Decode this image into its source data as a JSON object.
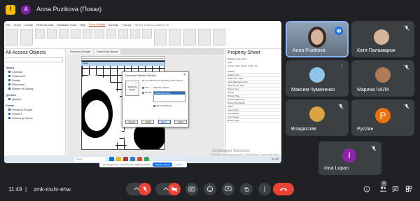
{
  "top_bar": {
    "presenter_initial": "A",
    "presenter_label": "Anna Puzikova (Показ)"
  },
  "shared_screen": {
    "ribbon_tabs": [
      "File",
      "Home",
      "Create",
      "External Data",
      "Database Tools",
      "Help",
      "Form Design",
      "Arrange",
      "Format"
    ],
    "active_ribbon_tab": "Form Design",
    "ribbon_search_hint": "Tell me what you want to do",
    "nav_pane": {
      "title": "All Access Objects",
      "groups": [
        {
          "name": "Tables",
          "items": [
            "Contract",
            "Customers",
            "People",
            "Personnel",
            "Sphere of Activity"
          ]
        },
        {
          "name": "Queries",
          "items": [
            "Query1"
          ]
        },
        {
          "name": "Forms",
          "items": [
            "Previous People",
            "People1",
            "Search by Name"
          ]
        }
      ]
    },
    "doc_tabs": [
      "Previous People",
      "Search by Name"
    ],
    "detail_label": "Detail",
    "wizard": {
      "title": "Command Button Wizard",
      "sample_text": "Search by Name",
      "question": "Do you want text or a picture on the button?",
      "option_text": "Text:",
      "option_text_value": "Search by Name",
      "option_picture": "Picture:",
      "picture_list_selected": "MS Access Form",
      "show_all_pictures": "Show All Pictures",
      "buttons": [
        "Cancel",
        "< Back",
        "Next >",
        "Finish"
      ]
    },
    "property_sheet": {
      "title": "Property Sheet",
      "selection_type": "Selection type: Form",
      "selected_object": "Form",
      "tabs": [
        "Format",
        "Data",
        "Event",
        "Other",
        "All"
      ],
      "rows": [
        "Caption",
        "Default View",
        "Allow Form View",
        "Allow Datasheet View",
        "Allow Layout View",
        "Picture Type",
        "Picture",
        "Picture Tiling",
        "Picture Alignment",
        "Picture Size Mode",
        "Width",
        "Auto Center",
        "Auto Resize",
        "Fit to Screen",
        "Border Style"
      ]
    },
    "watermark_lines": [
      "Активация Windows",
      "Чтобы активировать Windows, перейдите",
      "в раздел \"Параметры\"."
    ],
    "taskbar": {
      "search_text": "Поиск",
      "clock": "11:49"
    }
  },
  "share_banner": {
    "text": "meet.google.com: показ доступа к вашему экрану",
    "stop_label": "Закрыть доступ",
    "hide_label": "Скрыть"
  },
  "participants": [
    {
      "name": "Anna Puzikova",
      "kind": "video",
      "speaking": true
    },
    {
      "name": "Катя Паламарюк",
      "kind": "photo"
    },
    {
      "name": "Максим Чумаченко",
      "kind": "photo"
    },
    {
      "name": "Марина ЧАЛА",
      "kind": "photo"
    },
    {
      "name": "Владислав",
      "kind": "photo"
    },
    {
      "name": "Руслан",
      "kind": "letter",
      "letter": "Р",
      "color": "#e8710a"
    },
    {
      "name": "Irina Lupan",
      "kind": "letter",
      "letter": "I",
      "color": "#8e24aa"
    }
  ],
  "bottom_bar": {
    "time": "11:49",
    "separator": "|",
    "meeting_code": "zmk-muhr-ehw",
    "people_count": "8",
    "colors": {
      "hang_up": "#ea4335",
      "muted": "#ea4335",
      "control": "#3c4043"
    }
  }
}
